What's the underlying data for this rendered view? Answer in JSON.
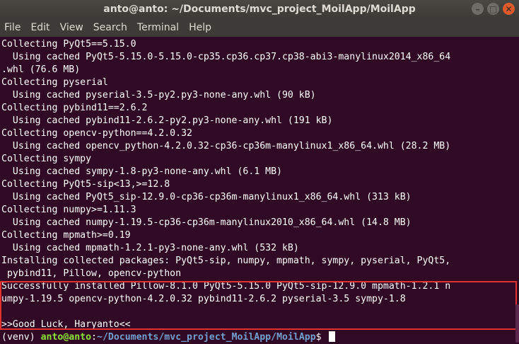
{
  "window": {
    "title": "anto@anto: ~/Documents/mvc_project_MoilApp/MoilApp",
    "minimize_glyph": "–",
    "maximize_glyph": "□",
    "close_glyph": "✕"
  },
  "menu": [
    "File",
    "Edit",
    "View",
    "Search",
    "Terminal",
    "Help"
  ],
  "output": [
    "Collecting PyQt5==5.15.0",
    "  Using cached PyQt5-5.15.0-5.15.0-cp35.cp36.cp37.cp38-abi3-manylinux2014_x86_64",
    ".whl (76.6 MB)",
    "Collecting pyserial",
    "  Using cached pyserial-3.5-py2.py3-none-any.whl (90 kB)",
    "Collecting pybind11==2.6.2",
    "  Using cached pybind11-2.6.2-py2.py3-none-any.whl (191 kB)",
    "Collecting opencv-python==4.2.0.32",
    "  Using cached opencv_python-4.2.0.32-cp36-cp36m-manylinux1_x86_64.whl (28.2 MB)",
    "Collecting sympy",
    "  Using cached sympy-1.8-py3-none-any.whl (6.1 MB)",
    "Collecting PyQt5-sip<13,>=12.8",
    "  Using cached PyQt5_sip-12.9.0-cp36-cp36m-manylinux1_x86_64.whl (313 kB)",
    "Collecting numpy>=1.11.3",
    "  Using cached numpy-1.19.5-cp36-cp36m-manylinux2010_x86_64.whl (14.8 MB)",
    "Collecting mpmath>=0.19",
    "  Using cached mpmath-1.2.1-py3-none-any.whl (532 kB)",
    "Installing collected packages: PyQt5-sip, numpy, mpmath, sympy, pyserial, PyQt5,",
    " pybind11, Pillow, opencv-python",
    "Successfully installed Pillow-8.1.0 PyQt5-5.15.0 PyQt5-sip-12.9.0 mpmath-1.2.1 n",
    "umpy-1.19.5 opencv-python-4.2.0.32 pybind11-2.6.2 pyserial-3.5 sympy-1.8",
    "",
    ">>Good Luck, Haryanto<<"
  ],
  "prompt": {
    "venv": "(venv) ",
    "user": "anto@anto",
    "sep": ":",
    "path": "~/Documents/mvc_project_MoilApp/MoilApp",
    "symbol": "$ "
  },
  "colors": {
    "background": "#300a24",
    "text": "#ffffff",
    "prompt_user": "#8ae234",
    "prompt_path": "#729fcf",
    "highlight_border": "#e03030"
  }
}
